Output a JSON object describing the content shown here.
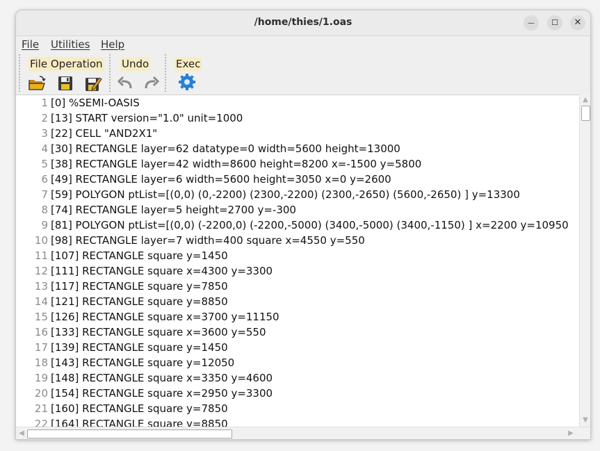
{
  "window": {
    "title": "/home/thies/1.oas",
    "controls": {
      "minimize": "—",
      "maximize": "☐",
      "close": "✕"
    }
  },
  "menubar": {
    "items": [
      "File",
      "Utilities",
      "Help"
    ]
  },
  "toolbar": {
    "groups": [
      {
        "label": "File Operation",
        "buttons": [
          "open-folder-icon",
          "save-icon",
          "save-as-icon"
        ]
      },
      {
        "label": "Undo",
        "buttons": [
          "undo-icon",
          "redo-icon"
        ]
      },
      {
        "label": "Exec",
        "buttons": [
          "gear-icon"
        ]
      }
    ]
  },
  "editor": {
    "lines": [
      {
        "num": "1",
        "text": "[0] %SEMI-OASIS"
      },
      {
        "num": "2",
        "text": "[13] START version=\"1.0\" unit=1000"
      },
      {
        "num": "3",
        "text": "[22] CELL \"AND2X1\""
      },
      {
        "num": "4",
        "text": "[30] RECTANGLE layer=62 datatype=0 width=5600 height=13000"
      },
      {
        "num": "5",
        "text": "[38] RECTANGLE layer=42 width=8600 height=8200 x=-1500 y=5800"
      },
      {
        "num": "6",
        "text": "[49] RECTANGLE layer=6 width=5600 height=3050 x=0 y=2600"
      },
      {
        "num": "7",
        "text": "[59] POLYGON ptList=[(0,0) (0,-2200) (2300,-2200) (2300,-2650) (5600,-2650) ] y=13300"
      },
      {
        "num": "8",
        "text": "[74] RECTANGLE layer=5 height=2700 y=-300"
      },
      {
        "num": "9",
        "text": "[81] POLYGON ptList=[(0,0) (-2200,0) (-2200,-5000) (3400,-5000) (3400,-1150) ] x=2200 y=10950"
      },
      {
        "num": "10",
        "text": "[98] RECTANGLE layer=7 width=400 square x=4550 y=550"
      },
      {
        "num": "11",
        "text": "[107] RECTANGLE square y=1450"
      },
      {
        "num": "12",
        "text": "[111] RECTANGLE square x=4300 y=3300"
      },
      {
        "num": "13",
        "text": "[117] RECTANGLE square y=7850"
      },
      {
        "num": "14",
        "text": "[121] RECTANGLE square y=8850"
      },
      {
        "num": "15",
        "text": "[126] RECTANGLE square x=3700 y=11150"
      },
      {
        "num": "16",
        "text": "[133] RECTANGLE square x=3600 y=550"
      },
      {
        "num": "17",
        "text": "[139] RECTANGLE square y=1450"
      },
      {
        "num": "18",
        "text": "[143] RECTANGLE square y=12050"
      },
      {
        "num": "19",
        "text": "[148] RECTANGLE square x=3350 y=4600"
      },
      {
        "num": "20",
        "text": "[154] RECTANGLE square x=2950 y=3300"
      },
      {
        "num": "21",
        "text": "[160] RECTANGLE square y=7850"
      },
      {
        "num": "22",
        "text": "[164] RECTANGLE square y=8850"
      }
    ]
  },
  "colors": {
    "group_label_bg": "#f7ecc4",
    "line_number": "#8a8a8a",
    "gear_blue": "#2a7fd4",
    "folder_yellow": "#e8b020"
  }
}
